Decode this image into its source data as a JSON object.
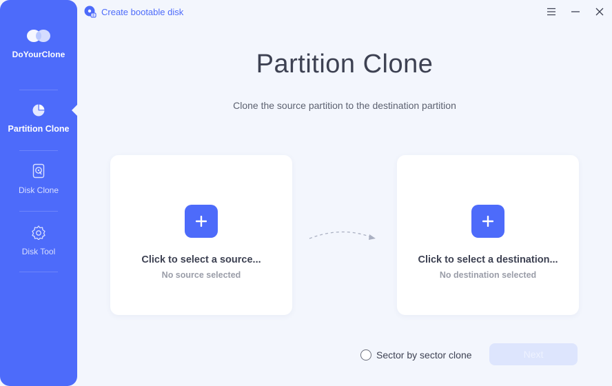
{
  "app": {
    "name": "DoYourClone"
  },
  "topbar": {
    "bootable_label": "Create bootable disk",
    "bootable_icon": "disk-bootable-icon",
    "controls": [
      "menu-icon",
      "minimize-icon",
      "close-icon"
    ]
  },
  "sidebar": {
    "items": [
      {
        "label": "Partition Clone",
        "icon": "pie-chart-icon",
        "active": true
      },
      {
        "label": "Disk Clone",
        "icon": "disk-clone-icon",
        "active": false
      },
      {
        "label": "Disk Tool",
        "icon": "gear-tool-icon",
        "active": false
      }
    ]
  },
  "main": {
    "title": "Partition Clone",
    "subtitle": "Clone the source partition to the destination partition",
    "source": {
      "title": "Click to select a source...",
      "status": "No source selected"
    },
    "destination": {
      "title": "Click to select a destination...",
      "status": "No destination selected"
    },
    "sector_option": {
      "label": "Sector by sector clone",
      "checked": false
    },
    "next_label": "Next",
    "next_enabled": false
  },
  "colors": {
    "accent": "#4d6bfa",
    "background": "#f3f6fd",
    "card": "#ffffff",
    "title_text": "#3d4152",
    "muted_text": "#9a9da8",
    "disabled_button": "#dde5fd"
  }
}
